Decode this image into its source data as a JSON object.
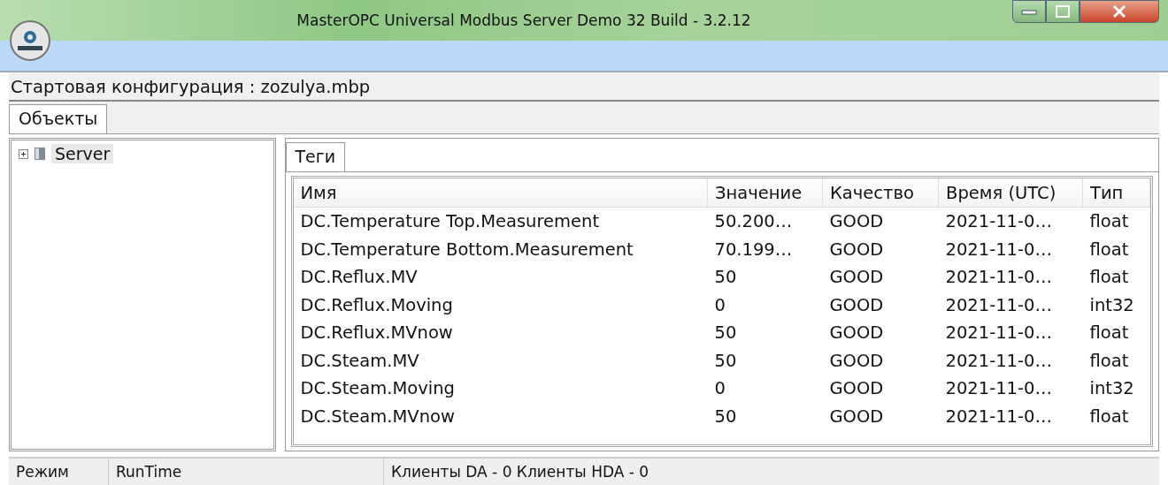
{
  "window": {
    "title": "MasterOPC Universal Modbus Server Demo 32 Build - 3.2.12"
  },
  "config_line": "Стартовая конфигурация : zozulya.mbp",
  "main_tabs": [
    {
      "label": "Объекты",
      "selected": true
    }
  ],
  "tree": {
    "items": [
      {
        "label": "Server",
        "expanded": false,
        "selected": true
      }
    ]
  },
  "tag_tabs": [
    {
      "label": "Теги",
      "selected": true
    }
  ],
  "table": {
    "columns": [
      "Имя",
      "Значение",
      "Качество",
      "Время (UTC)",
      "Тип"
    ],
    "rows": [
      [
        "DC.Temperature Top.Measurement",
        "50.200…",
        "GOOD",
        "2021-11-0…",
        "float"
      ],
      [
        "DC.Temperature Bottom.Measurement",
        "70.199…",
        "GOOD",
        "2021-11-0…",
        "float"
      ],
      [
        "DC.Reflux.MV",
        "50",
        "GOOD",
        "2021-11-0…",
        "float"
      ],
      [
        "DC.Reflux.Moving",
        "0",
        "GOOD",
        "2021-11-0…",
        "int32"
      ],
      [
        "DC.Reflux.MVnow",
        "50",
        "GOOD",
        "2021-11-0…",
        "float"
      ],
      [
        "DC.Steam.MV",
        "50",
        "GOOD",
        "2021-11-0…",
        "float"
      ],
      [
        "DC.Steam.Moving",
        "0",
        "GOOD",
        "2021-11-0…",
        "int32"
      ],
      [
        "DC.Steam.MVnow",
        "50",
        "GOOD",
        "2021-11-0…",
        "float"
      ]
    ]
  },
  "status_bar": [
    "Режим",
    "RunTime",
    "Клиенты DA - 0 Клиенты HDA - 0"
  ]
}
